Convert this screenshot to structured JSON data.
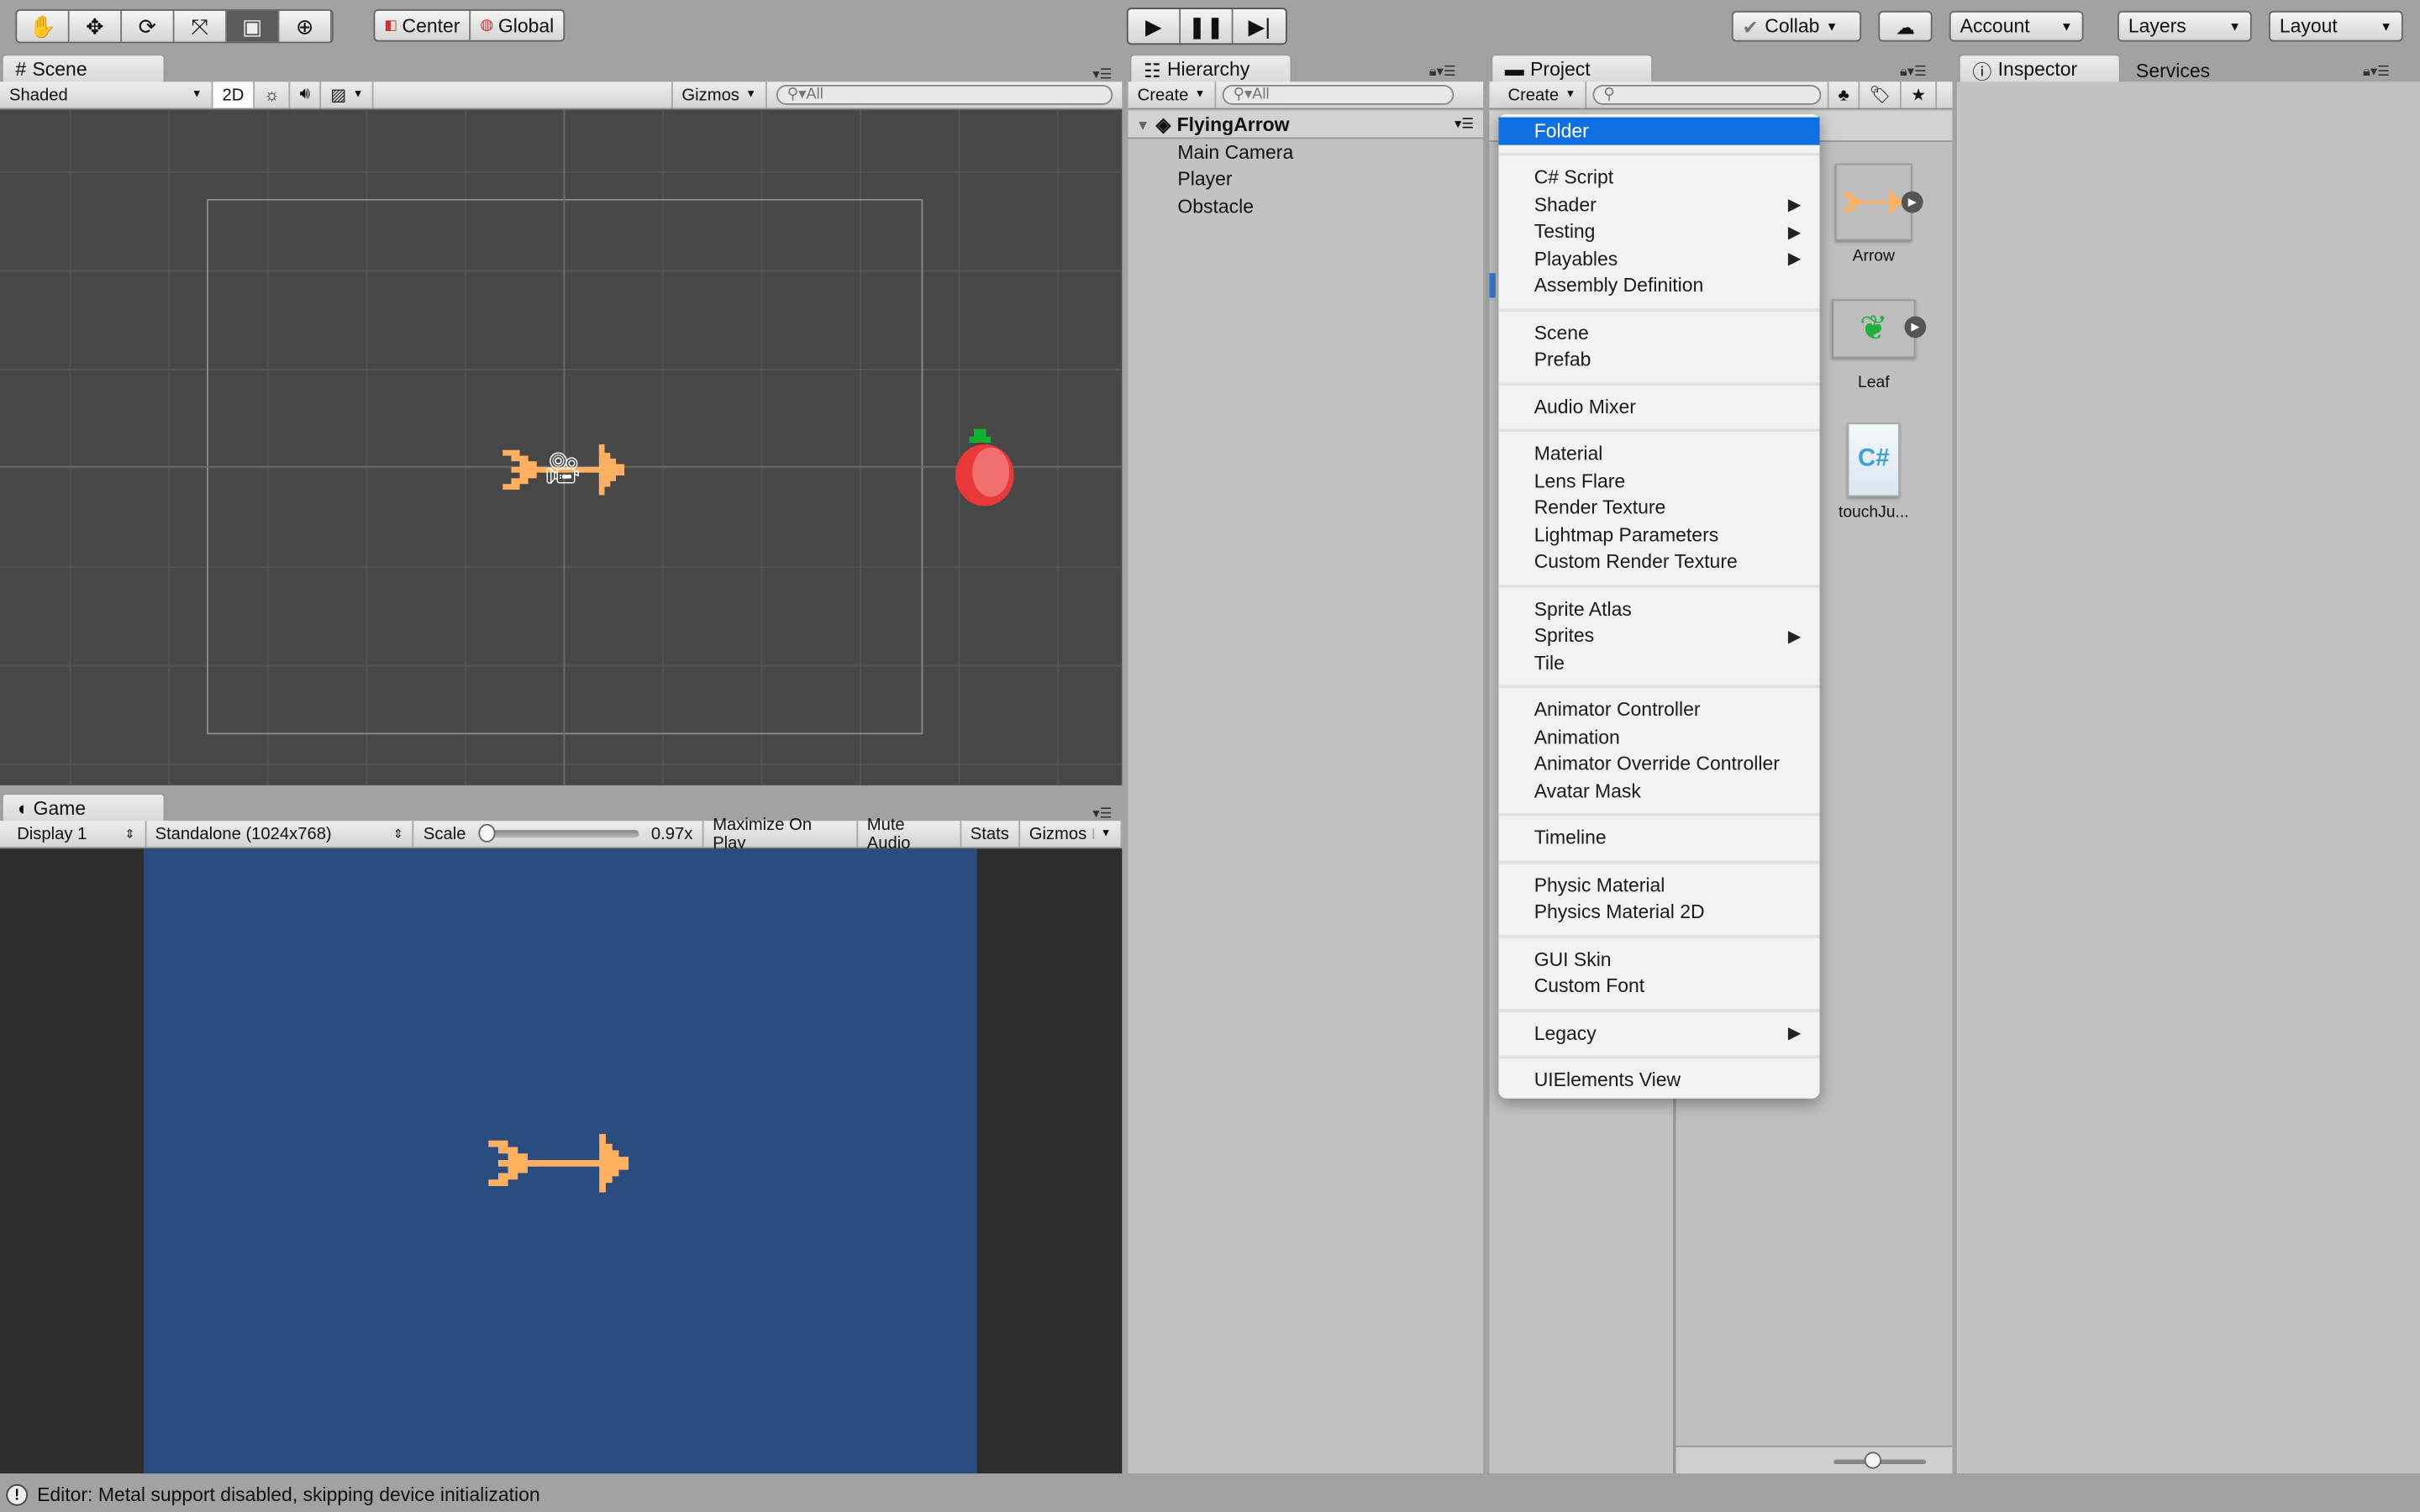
{
  "toolbar": {
    "tools": [
      "hand-tool",
      "move-tool",
      "rotate-tool",
      "scale-tool",
      "rect-tool",
      "transform-tool"
    ],
    "active_tool": "rect-tool",
    "pivot": "Center",
    "space": "Global",
    "collab": "Collab",
    "account": "Account",
    "layers": "Layers",
    "layout": "Layout"
  },
  "scene": {
    "tab": "Scene",
    "shading": "Shaded",
    "mode_2d": "2D",
    "gizmos": "Gizmos",
    "search_placeholder": "All"
  },
  "game": {
    "tab": "Game",
    "display": "Display 1",
    "resolution": "Standalone (1024x768)",
    "scale_label": "Scale",
    "scale_value": "0.97x",
    "scale_fraction": 0.97,
    "maximize": "Maximize On Play",
    "mute": "Mute Audio",
    "stats": "Stats",
    "gizmos": "Gizmos"
  },
  "hierarchy": {
    "tab": "Hierarchy",
    "create": "Create",
    "search_placeholder": "All",
    "scene_name": "FlyingArrow",
    "items": [
      "Main Camera",
      "Player",
      "Obstacle"
    ]
  },
  "project": {
    "tab": "Project",
    "create": "Create",
    "assets": [
      {
        "name": "Arrow"
      },
      {
        "name": "Leaf"
      },
      {
        "name": "touchJu..."
      }
    ]
  },
  "inspector": {
    "tab": "Inspector",
    "services_tab": "Services"
  },
  "create_menu": {
    "groups": [
      [
        {
          "label": "Folder",
          "highlighted": true
        }
      ],
      [
        {
          "label": "C# Script"
        },
        {
          "label": "Shader",
          "submenu": true
        },
        {
          "label": "Testing",
          "submenu": true
        },
        {
          "label": "Playables",
          "submenu": true
        },
        {
          "label": "Assembly Definition"
        }
      ],
      [
        {
          "label": "Scene"
        },
        {
          "label": "Prefab"
        }
      ],
      [
        {
          "label": "Audio Mixer"
        }
      ],
      [
        {
          "label": "Material"
        },
        {
          "label": "Lens Flare"
        },
        {
          "label": "Render Texture"
        },
        {
          "label": "Lightmap Parameters"
        },
        {
          "label": "Custom Render Texture"
        }
      ],
      [
        {
          "label": "Sprite Atlas"
        },
        {
          "label": "Sprites",
          "submenu": true
        },
        {
          "label": "Tile"
        }
      ],
      [
        {
          "label": "Animator Controller"
        },
        {
          "label": "Animation"
        },
        {
          "label": "Animator Override Controller"
        },
        {
          "label": "Avatar Mask"
        }
      ],
      [
        {
          "label": "Timeline"
        }
      ],
      [
        {
          "label": "Physic Material"
        },
        {
          "label": "Physics Material 2D"
        }
      ],
      [
        {
          "label": "GUI Skin"
        },
        {
          "label": "Custom Font"
        }
      ],
      [
        {
          "label": "Legacy",
          "submenu": true
        }
      ],
      [
        {
          "label": "UIElements View"
        }
      ]
    ]
  },
  "status": {
    "message": "Editor: Metal support disabled, skipping device initialization"
  },
  "colors": {
    "arrow": "#ffb060",
    "game_bg": "#2b4c7e",
    "scene_bg": "#474747",
    "menu_highlight": "#0f6fe0"
  }
}
